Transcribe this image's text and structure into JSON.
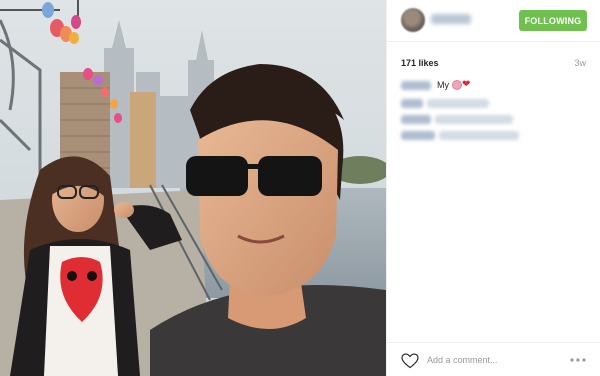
{
  "post": {
    "username": "",
    "follow_label": "FOLLOWING",
    "likes": "171 likes",
    "age": "3w",
    "caption": "My",
    "caption_emoji": [
      "pig-face-emoji",
      "red-heart-emoji"
    ],
    "comment_placeholder": "Add a comment...",
    "icons": {
      "like": "heart-outline-icon",
      "more": "ellipsis-icon"
    },
    "colors": {
      "follow_button": "#70c050",
      "meta_text": "#999999",
      "divider": "#efefef"
    }
  }
}
